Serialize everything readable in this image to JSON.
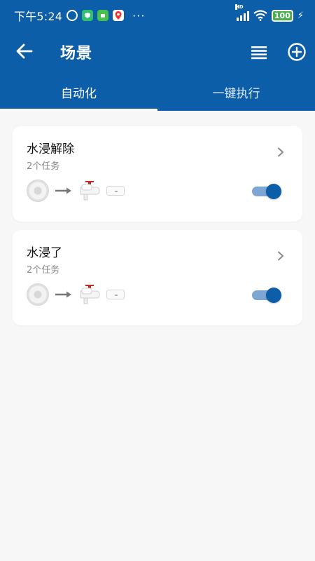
{
  "status_bar": {
    "time": "下午5:24",
    "dots": "···",
    "signal_label": "HD",
    "battery": "100"
  },
  "app_bar": {
    "title": "场景"
  },
  "tabs": [
    {
      "label": "自动化",
      "active": true
    },
    {
      "label": "一键执行",
      "active": false
    }
  ],
  "scenes": [
    {
      "name": "水浸解除",
      "tasks": "2个任务",
      "enabled": true
    },
    {
      "name": "水浸了",
      "tasks": "2个任务",
      "enabled": true
    }
  ],
  "colors": {
    "primary": "#0d5ea8",
    "toggle_track": "#7ea6d2",
    "background": "#f7f7f7",
    "battery": "#4caf50"
  }
}
